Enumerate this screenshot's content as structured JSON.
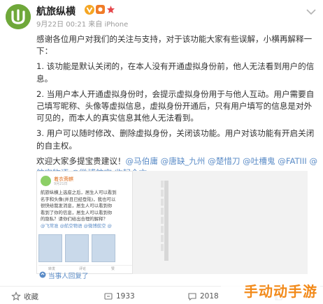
{
  "header": {
    "username": "航旅纵横",
    "timestamp": "9月22日",
    "time": "00:21",
    "source_prefix": "来自",
    "source": "iPhone",
    "avatar_color": "#6fa83a",
    "verified_color": "#f5a623"
  },
  "post": {
    "para1": "感谢各位用户对我们的关注与支持，对于该功能大家有些误解，小横再解释一下：",
    "para2": "1. 该功能是默认关闭的，在本人没有开通虚拟身份前，他人无法看到用户的信息。",
    "para3": "2. 当用户本人开通虚拟身份时，会提示虚拟身份用于与他人互动。用户需要自己填写昵称、头像等虚拟信息，虚拟身份开通后，只有用户填写的信息是对外可见的，而本人的真实信息其他人无法看到。",
    "para4": "3. 用户可以随时修改、删除虚拟身份，关闭该功能。用户对该功能有开启关闭的自主权。",
    "para5_prefix": "欢迎大家多提宝贵建议！",
    "mentions": [
      "@马伯庸",
      "@唐缺_九州",
      "@楚惜刀",
      "@吐槽鬼",
      "@FATIII",
      "@航空物语",
      "@微博航空"
    ],
    "expand": "收起全文",
    "link_color": "#5b8cc7"
  },
  "embedded": {
    "name": "着衣斋麒",
    "meta": "9月21日",
    "text_lines": [
      "航旅纵横上选座之后，居生人可以看到",
      "名字和头像(并且已经登陆)，我也可以",
      "很快给我发消息，居生人可以看到你",
      "看到了你的信息，居生人可以看到你",
      "的隐私？请你们给出合理的解释？",
      "@飞常准 @航空物语 @微博航空 @"
    ],
    "foot": [
      "转发",
      "评论",
      "赞"
    ]
  },
  "reply_label": "当事人回复了",
  "actions": {
    "forward": "收藏",
    "repost_count": "1933",
    "comment_count": "2018",
    "like_count": "",
    "accent": "#555555"
  },
  "watermark": "手动动手游"
}
